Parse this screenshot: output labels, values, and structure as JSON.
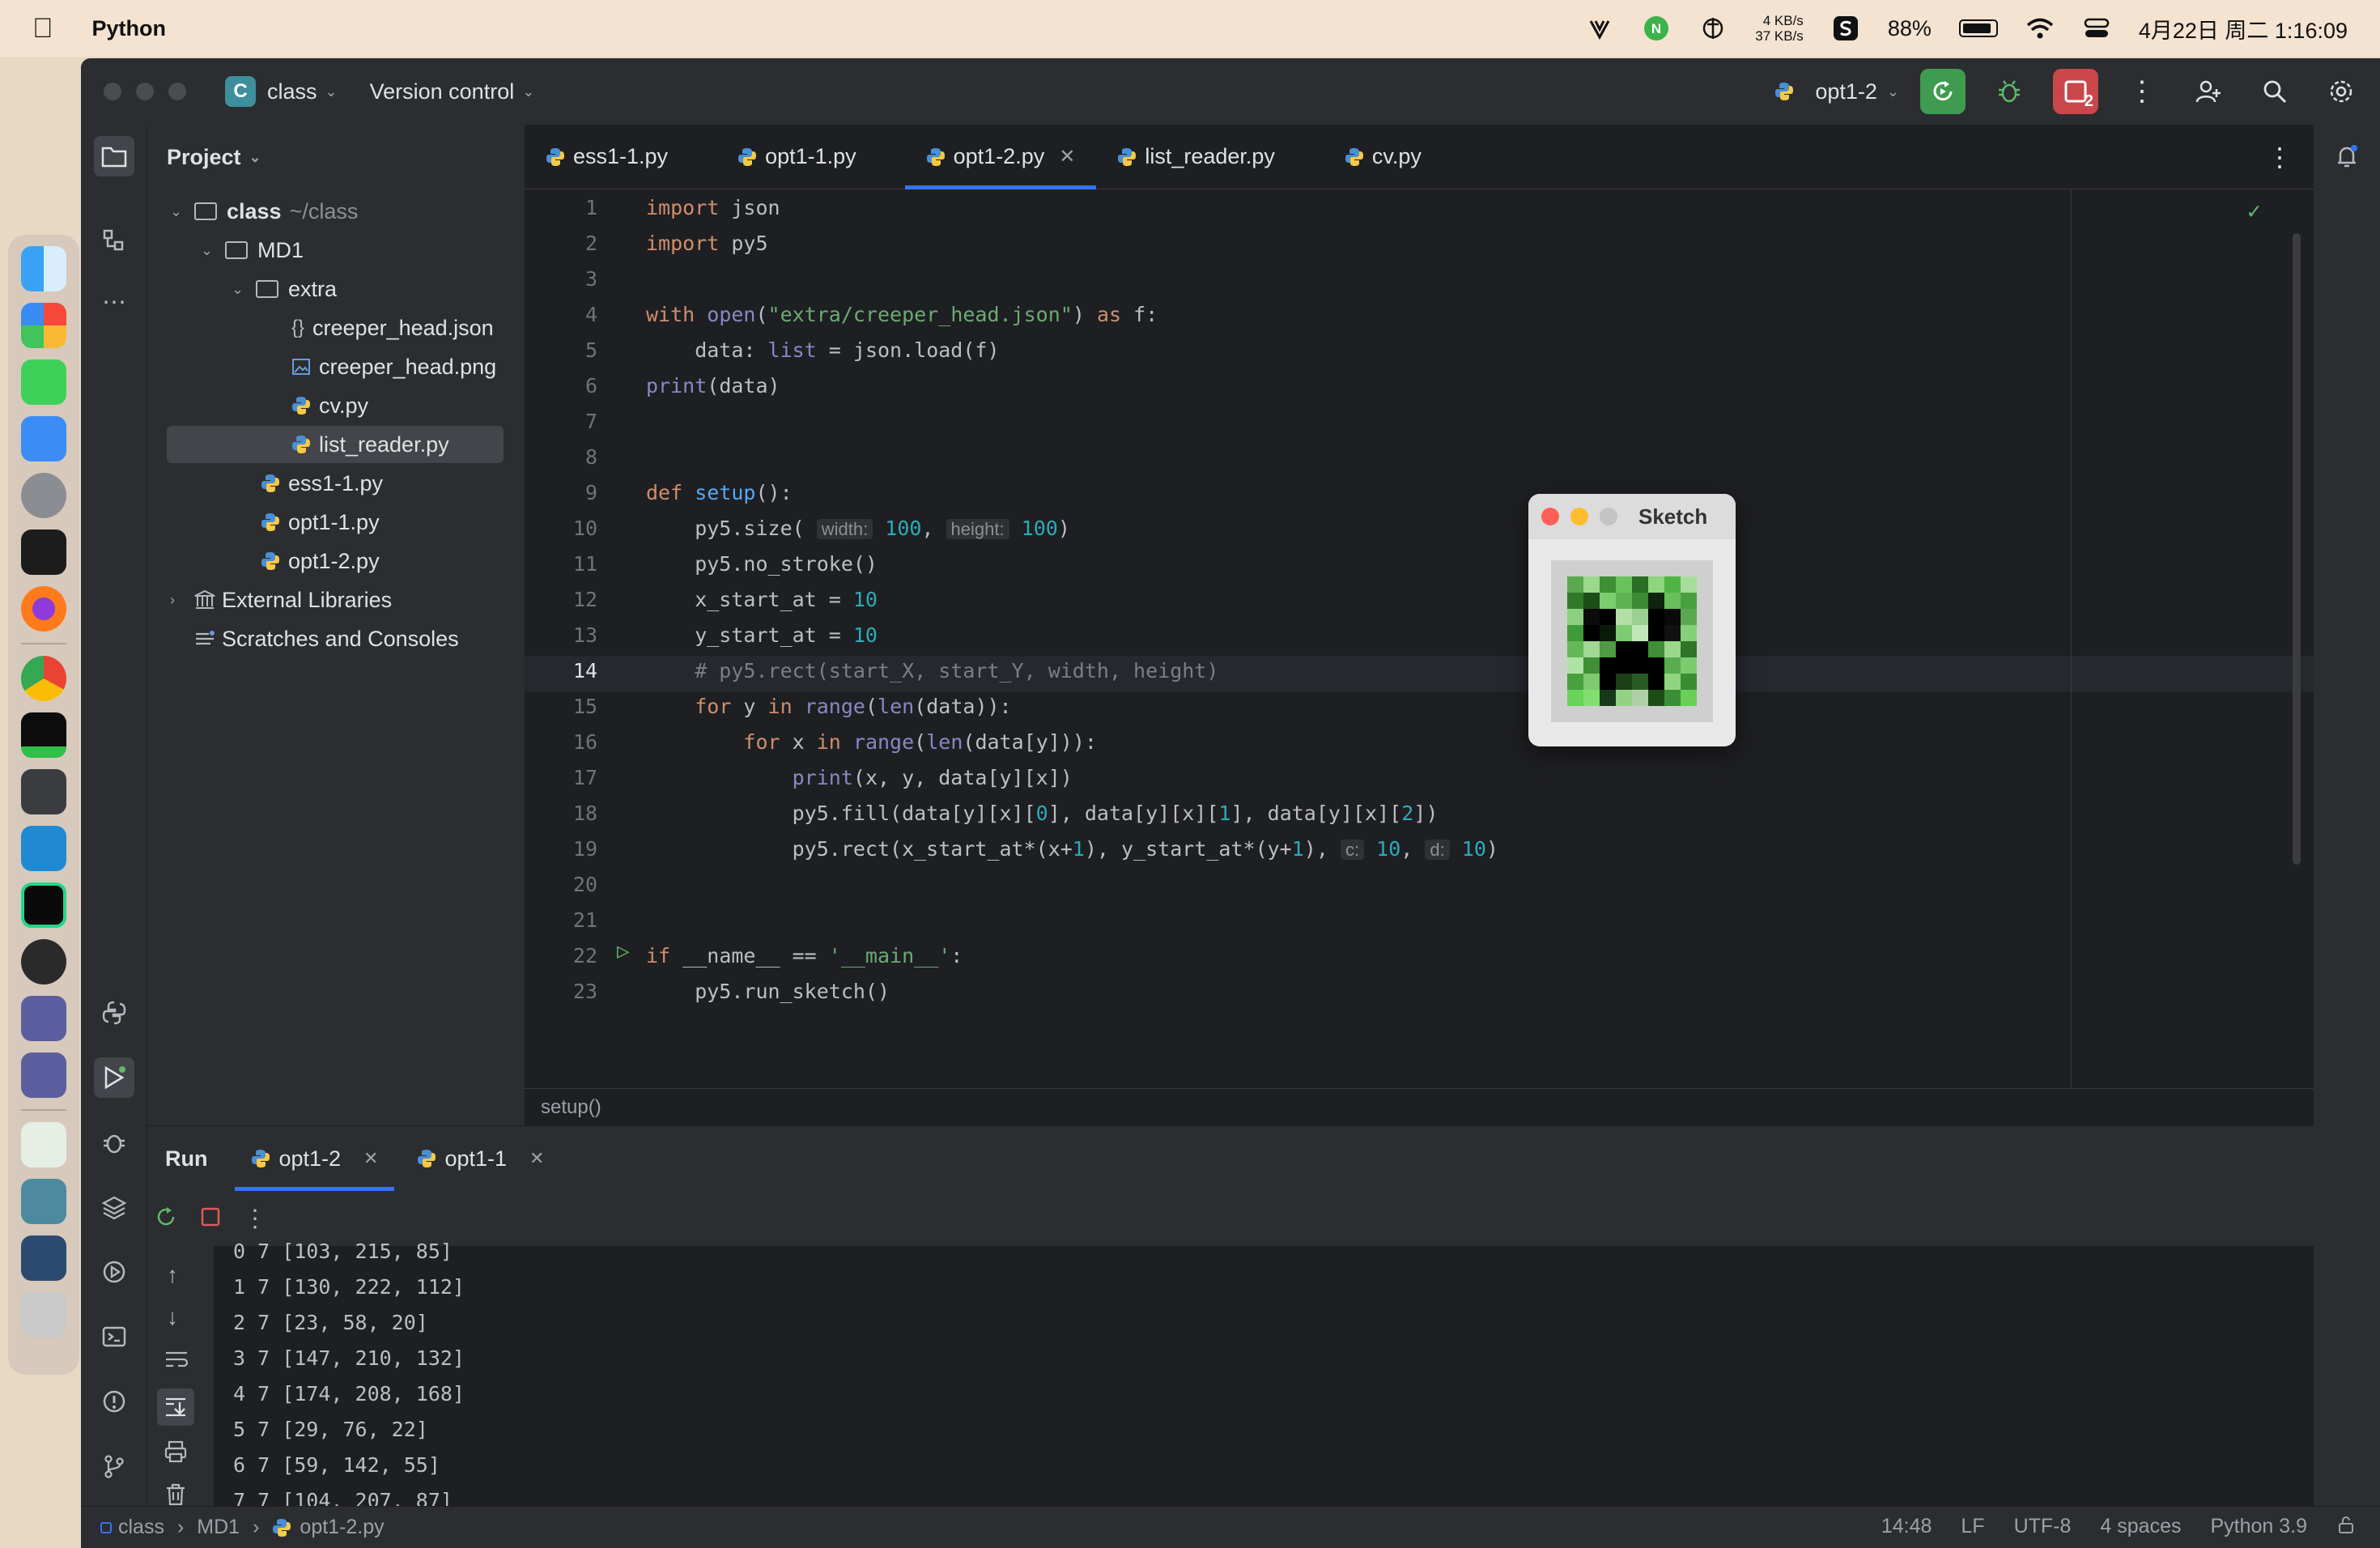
{
  "menubar": {
    "app_name": "Python",
    "net_up": "4 KB/s",
    "net_down": "37 KB/s",
    "battery": "88%",
    "datetime": "4月22日 周二  1:16:09"
  },
  "titlebar": {
    "project_badge": "C",
    "project_name": "class",
    "vcs": "Version control",
    "run_config": "opt1-2",
    "stop_badge": "2"
  },
  "project": {
    "header": "Project",
    "items": [
      {
        "label": "class",
        "dim": "~/class"
      },
      {
        "label": "MD1"
      },
      {
        "label": "extra"
      },
      {
        "label": "creeper_head.json"
      },
      {
        "label": "creeper_head.png"
      },
      {
        "label": "cv.py"
      },
      {
        "label": "list_reader.py"
      },
      {
        "label": "ess1-1.py"
      },
      {
        "label": "opt1-1.py"
      },
      {
        "label": "opt1-2.py"
      },
      {
        "label": "External Libraries"
      },
      {
        "label": "Scratches and Consoles"
      }
    ]
  },
  "tabs": [
    "ess1-1.py",
    "opt1-1.py",
    "opt1-2.py",
    "list_reader.py",
    "cv.py"
  ],
  "active_tab": "opt1-2.py",
  "code": {
    "line_numbers": [
      "1",
      "2",
      "3",
      "4",
      "5",
      "6",
      "7",
      "8",
      "9",
      "10",
      "11",
      "12",
      "13",
      "14",
      "15",
      "16",
      "17",
      "18",
      "19",
      "20",
      "21",
      "22",
      "23"
    ],
    "l1a": "import",
    "l1b": " json",
    "l2a": "import",
    "l2b": " py5",
    "l4a": "with ",
    "l4b": "open",
    "l4c": "(",
    "l4d": "\"extra/creeper_head.json\"",
    "l4e": ") ",
    "l4f": "as",
    "l4g": " f:",
    "l5a": "    data: ",
    "l5b": "list",
    "l5c": " = json.load(f)",
    "l6a": "print",
    "l6b": "(data)",
    "l9a": "def ",
    "l9b": "setup",
    "l9c": "():",
    "l10a": "    py5.size( ",
    "l10h1": "width:",
    "l10b": " ",
    "l10n1": "100",
    "l10c": ", ",
    "l10h2": "height:",
    "l10d": " ",
    "l10n2": "100",
    "l10e": ")",
    "l11": "    py5.no_stroke()",
    "l12a": "    x_start_at = ",
    "l12b": "10",
    "l13a": "    y_start_at = ",
    "l13b": "10",
    "l14": "    # py5.rect(start_X, start_Y, width, height)",
    "l15a": "    ",
    "l15b": "for",
    "l15c": " y ",
    "l15d": "in",
    "l15e": " ",
    "l15f": "range",
    "l15g": "(",
    "l15h": "len",
    "l15i": "(data)):",
    "l16a": "        ",
    "l16b": "for",
    "l16c": " x ",
    "l16d": "in",
    "l16e": " ",
    "l16f": "range",
    "l16g": "(",
    "l16h": "len",
    "l16i": "(data[y])):",
    "l17a": "            ",
    "l17b": "print",
    "l17c": "(x, y, data[y][x])",
    "l18a": "            py5.fill(data[y][x][",
    "l18n0": "0",
    "l18b": "], data[y][x][",
    "l18n1": "1",
    "l18c": "], data[y][x][",
    "l18n2": "2",
    "l18d": "])",
    "l19a": "            py5.rect(x_start_at*(x+",
    "l19n1": "1",
    "l19b": "), y_start_at*(y+",
    "l19n2": "1",
    "l19c": "), ",
    "l19h1": "c:",
    "l19d": " ",
    "l19n3": "10",
    "l19e": ", ",
    "l19h2": "d:",
    "l19f": " ",
    "l19n4": "10",
    "l19g": ")",
    "l22a": "if",
    "l22b": " __name__ == ",
    "l22c": "'__main__'",
    "l22d": ":",
    "l23": "    py5.run_sketch()"
  },
  "editor_breadcrumb": "setup()",
  "run": {
    "label": "Run",
    "tabs": [
      "opt1-2",
      "opt1-1"
    ],
    "console": [
      "0 7 [103, 215, 85]",
      "1 7 [130, 222, 112]",
      "2 7 [23, 58, 20]",
      "3 7 [147, 210, 132]",
      "4 7 [174, 208, 168]",
      "5 7 [29, 76, 22]",
      "6 7 [59, 142, 55]",
      "7 7 [104, 207, 87]"
    ]
  },
  "status": {
    "path": [
      "class",
      "MD1",
      "opt1-2.py"
    ],
    "position": "14:48",
    "line_sep": "LF",
    "encoding": "UTF-8",
    "indent": "4 spaces",
    "interpreter": "Python 3.9"
  },
  "sketch": {
    "title": "Sketch",
    "pixels": [
      [
        "#5aa84f",
        "#9bd88c",
        "#3f8f36",
        "#6cc15f",
        "#2a6d24",
        "#8fd47e",
        "#4fb444",
        "#a6dd9a"
      ],
      [
        "#2f7a29",
        "#1d4d18",
        "#7bcd6d",
        "#5fb353",
        "#3d8a35",
        "#0f240c",
        "#69bf5c",
        "#4aa040"
      ],
      [
        "#8cd17f",
        "#0c0c0c",
        "#000000",
        "#b4e0a8",
        "#9ccf92",
        "#000000",
        "#0a0a0a",
        "#5aa84f"
      ],
      [
        "#3f9a37",
        "#000000",
        "#0a1a08",
        "#7ecb71",
        "#c2e6ba",
        "#000000",
        "#111111",
        "#86d079"
      ],
      [
        "#64b857",
        "#a0d894",
        "#4f9a45",
        "#000000",
        "#000000",
        "#3f8f36",
        "#9bd88c",
        "#2e7527"
      ],
      [
        "#aee3a3",
        "#3f8f36",
        "#000000",
        "#000000",
        "#000000",
        "#000000",
        "#59ad4e",
        "#7ccc6e"
      ],
      [
        "#4a9f41",
        "#7ecb71",
        "#000000",
        "#1b3f16",
        "#2a5a23",
        "#000000",
        "#8fd47e",
        "#3b8c33"
      ],
      [
        "#67d357",
        "#82de70",
        "#17391a",
        "#93d284",
        "#aed0a8",
        "#1d4c16",
        "#3b8e37",
        "#68cf57"
      ]
    ]
  }
}
